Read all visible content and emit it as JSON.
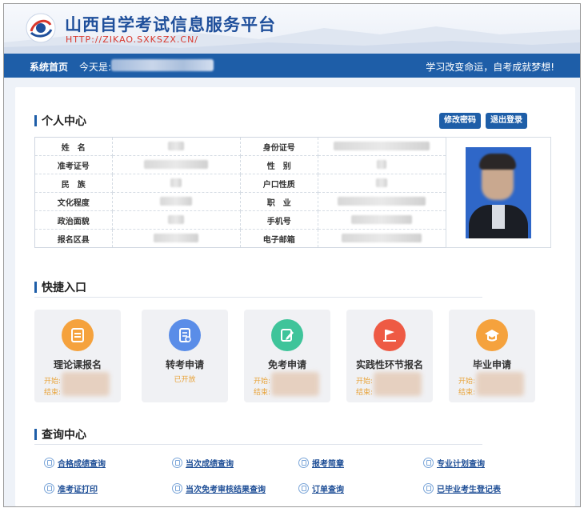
{
  "header": {
    "title": "山西自学考试信息服务平台",
    "url": "HTTP://ZIKAO.SXKSZX.CN/"
  },
  "nav": {
    "home": "系统首页",
    "today_label": "今天是:",
    "slogan": "学习改变命运，自考成就梦想!"
  },
  "personal": {
    "heading": "个人中心",
    "buttons": {
      "change_password": "修改密码",
      "logout": "退出登录"
    },
    "rows": [
      {
        "left_label": "姓　名",
        "right_label": "身份证号"
      },
      {
        "left_label": "准考证号",
        "right_label": "性　别"
      },
      {
        "left_label": "民　族",
        "right_label": "户口性质"
      },
      {
        "left_label": "文化程度",
        "right_label": "职　业"
      },
      {
        "left_label": "政治面貌",
        "right_label": "手机号"
      },
      {
        "left_label": "报名区县",
        "right_label": "电子邮箱"
      }
    ]
  },
  "shortcuts": {
    "heading": "快捷入口",
    "start_label": "开始:",
    "end_label": "结束:",
    "cards": [
      {
        "title": "理论课报名",
        "icon": "form-icon",
        "color": "#f5a23d",
        "status": ""
      },
      {
        "title": "转考申请",
        "icon": "document-icon",
        "color": "#5a8de8",
        "status": "已开放"
      },
      {
        "title": "免考申请",
        "icon": "edit-icon",
        "color": "#3fc49a",
        "status": ""
      },
      {
        "title": "实践性环节报名",
        "icon": "flag-icon",
        "color": "#ee5a44",
        "status": ""
      },
      {
        "title": "毕业申请",
        "icon": "graduation-cap-icon",
        "color": "#f5a23d",
        "status": ""
      }
    ]
  },
  "query": {
    "heading": "查询中心",
    "links": [
      "合格成绩查询",
      "当次成绩查询",
      "报考简章",
      "专业计划查询",
      "准考证打印",
      "当次免考审核结果查询",
      "订单查询",
      "已毕业考生登记表"
    ]
  }
}
